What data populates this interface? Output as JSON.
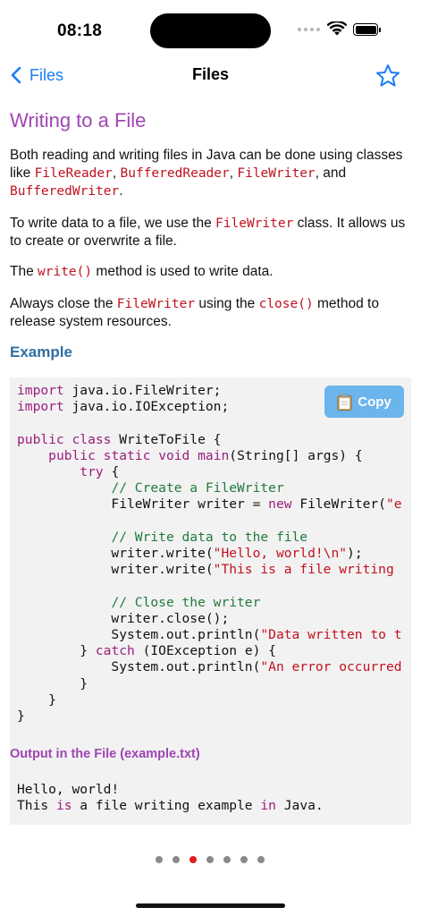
{
  "status_bar": {
    "time": "08:18"
  },
  "nav": {
    "back_label": "Files",
    "title": "Files"
  },
  "lesson": {
    "title": "Writing to a File",
    "para1": {
      "t1": "Both reading and writing files in Java can be done using classes like ",
      "c1": "FileReader",
      "t2": ", ",
      "c2": "BufferedReader",
      "t3": ", ",
      "c3": "FileWriter",
      "t4": ", and ",
      "c4": "BufferedWriter",
      "t5": "."
    },
    "para2": {
      "t1": "To write data to a file, we use the ",
      "c1": "FileWriter",
      "t2": " class. It allows us to create or overwrite a file."
    },
    "para3": {
      "t1": "The ",
      "c1": "write()",
      "t2": " method is used to write data."
    },
    "para4": {
      "t1": "Always close the ",
      "c1": "FileWriter",
      "t2": " using the ",
      "c2": "close()",
      "t3": " method to release system resources."
    },
    "example_heading": "Example",
    "copy_label": "Copy",
    "code_lines": [
      [
        {
          "k": "kw",
          "t": "import"
        },
        {
          "k": "",
          "t": " java.io.FileWriter;"
        }
      ],
      [
        {
          "k": "kw",
          "t": "import"
        },
        {
          "k": "",
          "t": " java.io.IOException;"
        }
      ],
      [],
      [
        {
          "k": "kw",
          "t": "public"
        },
        {
          "k": "",
          "t": " "
        },
        {
          "k": "kw",
          "t": "class"
        },
        {
          "k": "",
          "t": " WriteToFile {"
        }
      ],
      [
        {
          "k": "",
          "t": "    "
        },
        {
          "k": "kw",
          "t": "public"
        },
        {
          "k": "",
          "t": " "
        },
        {
          "k": "kw",
          "t": "static"
        },
        {
          "k": "",
          "t": " "
        },
        {
          "k": "kw",
          "t": "void"
        },
        {
          "k": "",
          "t": " "
        },
        {
          "k": "fn",
          "t": "main"
        },
        {
          "k": "",
          "t": "(String[] args) {"
        }
      ],
      [
        {
          "k": "",
          "t": "        "
        },
        {
          "k": "kw",
          "t": "try"
        },
        {
          "k": "",
          "t": " {"
        }
      ],
      [
        {
          "k": "",
          "t": "            "
        },
        {
          "k": "cm",
          "t": "// Create a FileWriter"
        }
      ],
      [
        {
          "k": "",
          "t": "            FileWriter writer = "
        },
        {
          "k": "kw",
          "t": "new"
        },
        {
          "k": "",
          "t": " FileWriter("
        },
        {
          "k": "str",
          "t": "\"e"
        }
      ],
      [],
      [
        {
          "k": "",
          "t": "            "
        },
        {
          "k": "cm",
          "t": "// Write data to the file"
        }
      ],
      [
        {
          "k": "",
          "t": "            writer.write("
        },
        {
          "k": "str",
          "t": "\"Hello, world!\\n\""
        },
        {
          "k": "",
          "t": ");"
        }
      ],
      [
        {
          "k": "",
          "t": "            writer.write("
        },
        {
          "k": "str",
          "t": "\"This is a file writing "
        }
      ],
      [],
      [
        {
          "k": "",
          "t": "            "
        },
        {
          "k": "cm",
          "t": "// Close the writer"
        }
      ],
      [
        {
          "k": "",
          "t": "            writer.close();"
        }
      ],
      [
        {
          "k": "",
          "t": "            System.out.println("
        },
        {
          "k": "str",
          "t": "\"Data written to t"
        }
      ],
      [
        {
          "k": "",
          "t": "        } "
        },
        {
          "k": "kw",
          "t": "catch"
        },
        {
          "k": "",
          "t": " (IOException e) {"
        }
      ],
      [
        {
          "k": "",
          "t": "            System.out.println("
        },
        {
          "k": "str",
          "t": "\"An error occurred"
        }
      ],
      [
        {
          "k": "",
          "t": "        }"
        }
      ],
      [
        {
          "k": "",
          "t": "    }"
        }
      ],
      [
        {
          "k": "",
          "t": "}"
        }
      ]
    ],
    "output_heading": "Output in the File (example.txt)",
    "output_lines": [
      [
        {
          "k": "",
          "t": "Hello, world!"
        }
      ],
      [
        {
          "k": "",
          "t": "This "
        },
        {
          "k": "kw",
          "t": "is"
        },
        {
          "k": "",
          "t": " a file writing example "
        },
        {
          "k": "kw",
          "t": "in"
        },
        {
          "k": "",
          "t": " Java."
        }
      ]
    ]
  },
  "pagination": {
    "count": 7,
    "active_index": 2
  },
  "colors": {
    "accent": "#1b7cf5",
    "title_purple": "#a045b3",
    "heading_blue": "#2f6ea3",
    "code_red": "#c1121f",
    "copy_button": "#6bb4ec",
    "active_dot": "#e21b1b"
  }
}
